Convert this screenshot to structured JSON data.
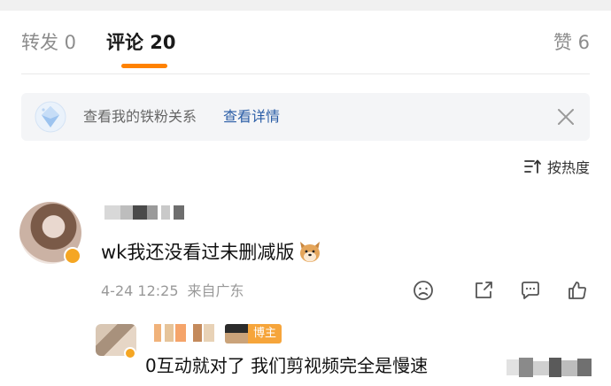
{
  "tabs": {
    "repost": "转发 0",
    "comments": "评论 20",
    "likes": "赞 6"
  },
  "banner": {
    "text": "查看我的铁粉关系",
    "link": "查看详情"
  },
  "sort": {
    "label": "按热度"
  },
  "comment": {
    "text": "wk我还没看过未删减版",
    "date": "4-24 12:25",
    "location": "来自广东"
  },
  "reply": {
    "tag": "博主",
    "text": "0互动就对了 我们剪视频完全是慢速"
  },
  "colors": {
    "accent": "#ff8200",
    "link": "#2a5da6",
    "muted": "#999999",
    "badge": "#f5a623"
  },
  "icons": {
    "banner": "diamond-badge-icon",
    "close": "close-icon",
    "sort": "sort-icon",
    "dislike": "frown-icon",
    "share": "share-icon",
    "reply": "comment-icon",
    "like": "thumbs-up-icon"
  }
}
